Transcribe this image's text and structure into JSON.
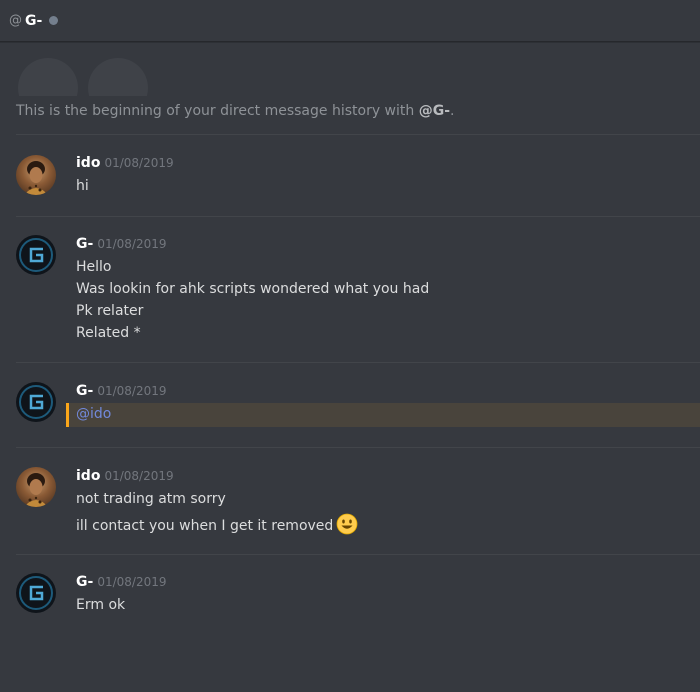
{
  "header": {
    "at_symbol": "@",
    "channel_name": "G-"
  },
  "intro": {
    "prefix": "This is the beginning of your direct message history with ",
    "user": "@G-",
    "suffix": "."
  },
  "messages": [
    {
      "author": "ido",
      "timestamp": "01/08/2019",
      "lines": [
        "hi"
      ]
    },
    {
      "author": "G-",
      "timestamp": "01/08/2019",
      "lines": [
        "Hello",
        "Was lookin for ahk scripts wondered what you had",
        "Pk relater",
        "Related *"
      ]
    },
    {
      "author": "G-",
      "timestamp": "01/08/2019",
      "lines": [
        "@ido"
      ]
    },
    {
      "author": "ido",
      "timestamp": "01/08/2019",
      "lines": [
        "not trading atm sorry",
        "ill contact you when I get it removed"
      ]
    },
    {
      "author": "G-",
      "timestamp": "01/08/2019",
      "lines": [
        "Erm ok"
      ]
    }
  ],
  "emoji": "smiley-emoji",
  "colors": {
    "background": "#36393f",
    "mention": "#7289da",
    "highlight_bar": "#faa61a"
  }
}
